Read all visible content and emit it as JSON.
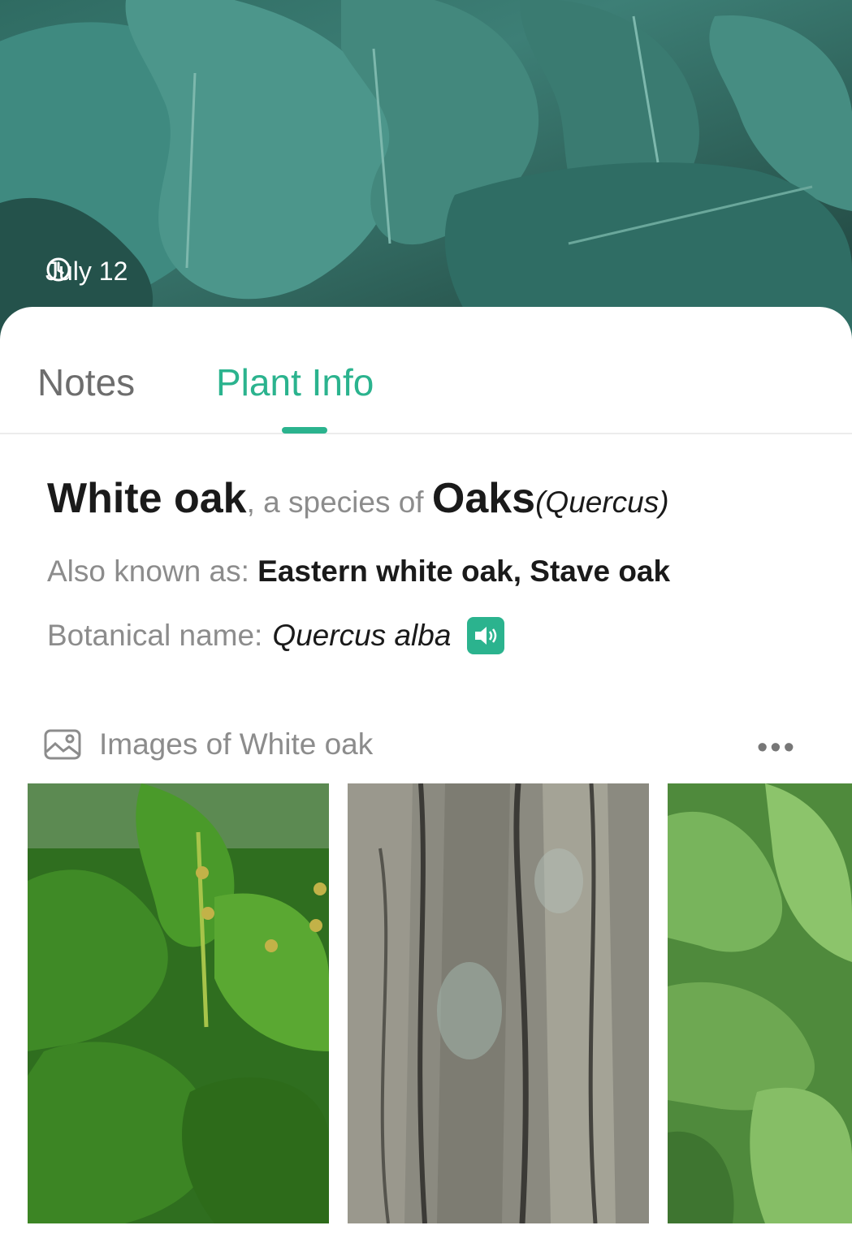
{
  "hero": {
    "date": "July 12"
  },
  "tabs": [
    {
      "label": "Notes",
      "active": false
    },
    {
      "label": "Plant Info",
      "active": true
    }
  ],
  "plant": {
    "common_name": "White oak",
    "species_of": ", a species of ",
    "genus": "Oaks",
    "genus_latin": "(Quercus)",
    "aka_label": "Also known as: ",
    "aka_value": "Eastern white oak, Stave oak",
    "botanical_label": "Botanical name:",
    "botanical_value": "Quercus alba"
  },
  "images": {
    "title": "Images of White oak",
    "more": "•••",
    "items": [
      {
        "alt": "oak leaves and acorns"
      },
      {
        "alt": "oak bark"
      },
      {
        "alt": "oak foliage"
      }
    ]
  },
  "colors": {
    "accent": "#2bb38e",
    "muted": "#8c8c8c",
    "text": "#1a1a1a"
  }
}
